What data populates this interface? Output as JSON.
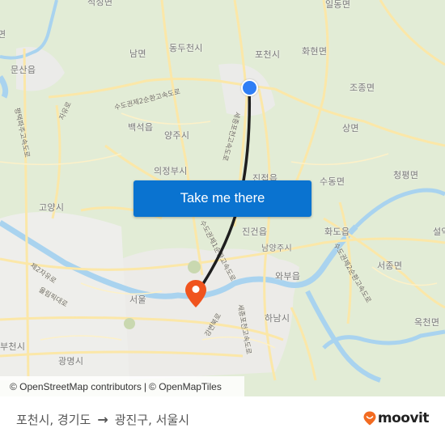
{
  "map": {
    "places": [
      {
        "name": "적성면",
        "label": "적성면"
      },
      {
        "name": "일동면",
        "label": "일동면"
      },
      {
        "name": "문산읍",
        "label": "문산읍"
      },
      {
        "name": "남면",
        "label": "남면"
      },
      {
        "name": "동두천시",
        "label": "동두천시"
      },
      {
        "name": "포천시",
        "label": "포천시"
      },
      {
        "name": "화현면",
        "label": "화현면"
      },
      {
        "name": "조종면",
        "label": "조종면"
      },
      {
        "name": "백석읍",
        "label": "백석읍"
      },
      {
        "name": "양주시",
        "label": "양주시"
      },
      {
        "name": "상면",
        "label": "상면"
      },
      {
        "name": "의정부시",
        "label": "의정부시"
      },
      {
        "name": "진접읍",
        "label": "진접읍"
      },
      {
        "name": "수동면",
        "label": "수동면"
      },
      {
        "name": "청평면",
        "label": "청평면"
      },
      {
        "name": "고양시",
        "label": "고양시"
      },
      {
        "name": "진건읍",
        "label": "진건읍"
      },
      {
        "name": "화도읍",
        "label": "화도읍"
      },
      {
        "name": "설악면",
        "label": "설악"
      },
      {
        "name": "남양주시",
        "label": "남양주시"
      },
      {
        "name": "서종면",
        "label": "서종면"
      },
      {
        "name": "와부읍",
        "label": "와부읍"
      },
      {
        "name": "서울",
        "label": "서울"
      },
      {
        "name": "하남시",
        "label": "하남시"
      },
      {
        "name": "옥천면",
        "label": "옥천면"
      },
      {
        "name": "부천시",
        "label": "부천시"
      },
      {
        "name": "광명시",
        "label": "광명시"
      },
      {
        "name": "미면",
        "label": "면"
      }
    ],
    "roads": [
      {
        "label": "수도권제2순환고속도로"
      },
      {
        "label": "자유로"
      },
      {
        "label": "평택파주고속도로"
      },
      {
        "label": "세종포천고속도로"
      },
      {
        "label": "제2자유로"
      },
      {
        "label": "올림픽대로"
      },
      {
        "label": "강변북로"
      },
      {
        "label": "수도권제1순환고속도로"
      },
      {
        "label": "세종포천고속도로"
      },
      {
        "label": "수도권제2순환고속도로"
      }
    ],
    "origin": {
      "label": "포천시, 경기도",
      "color": "#2f7ef5"
    },
    "destination": {
      "label": "광진구, 서울시",
      "color": "#f0541e"
    },
    "route_color": "#1e1e1e"
  },
  "cta": {
    "label": "Take me there",
    "color": "#0a73d0"
  },
  "attribution": {
    "osm": "© OpenStreetMap contributors",
    "separator": "|",
    "omt": "© OpenMapTiles"
  },
  "footer": {
    "origin": "포천시, 경기도",
    "arrow": "→",
    "destination": "광진구, 서울시",
    "brand": "moovit",
    "brand_color": "#f26b21"
  }
}
